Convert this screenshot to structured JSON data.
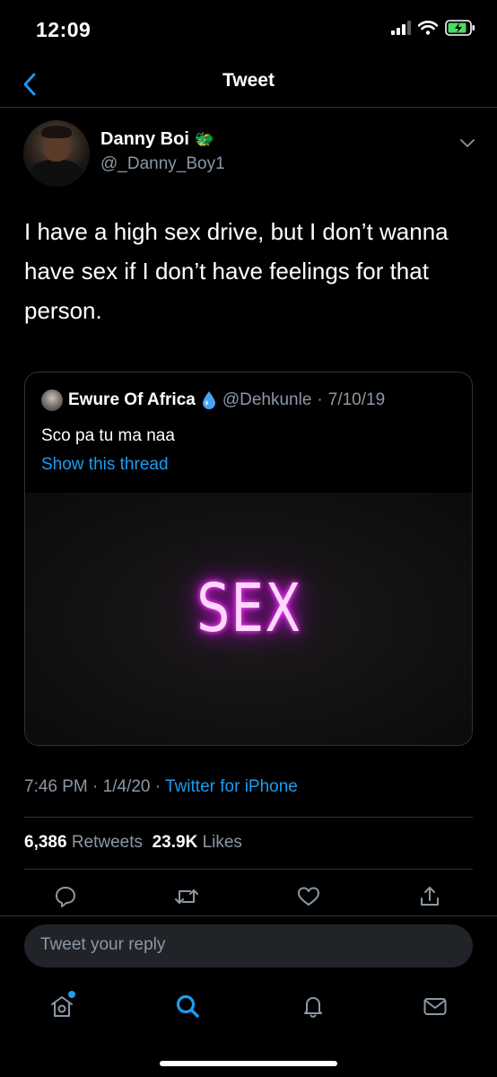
{
  "status_bar": {
    "time": "12:09",
    "battery_icon": "battery-charging-icon"
  },
  "header": {
    "title": "Tweet",
    "back_icon": "chevron-left-icon"
  },
  "tweet": {
    "author_name": "Danny Boi",
    "author_emoji": "🐲",
    "author_handle": "@_Danny_Boy1",
    "text": "I have a high sex drive, but I don’t wanna have sex if I don’t have feelings for that person.",
    "time": "7:46 PM",
    "date": "1/4/20",
    "source": "Twitter for iPhone",
    "retweets_count": "6,386",
    "retweets_label": "Retweets",
    "likes_count": "23.9K",
    "likes_label": "Likes"
  },
  "quoted_tweet": {
    "author_name": "Ewure Of Africa",
    "author_emoji": "💧",
    "author_handle": "@Dehkunle",
    "date": "7/10/19",
    "text": "Sco pa tu ma naa",
    "thread_link": "Show this thread",
    "media_text": "SEX"
  },
  "actions": [
    "reply-icon",
    "retweet-icon",
    "like-icon",
    "share-icon"
  ],
  "reply_box": {
    "placeholder": "Tweet your reply"
  },
  "tab_bar": [
    "home-icon",
    "search-icon",
    "notifications-icon",
    "messages-icon"
  ],
  "colors": {
    "accent": "#1d9bf0",
    "background": "#000000",
    "secondary_text": "#8b98a5",
    "border": "#2f3336"
  }
}
